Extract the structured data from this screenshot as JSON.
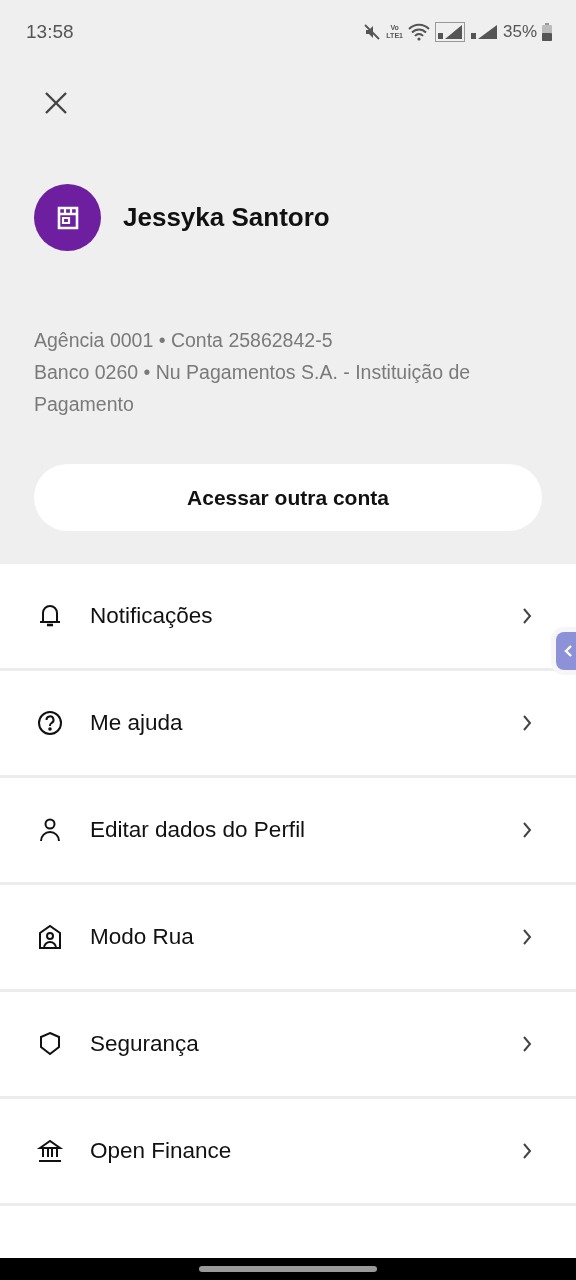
{
  "status_bar": {
    "time": "13:58",
    "network_label": [
      "Vo",
      "LTE1"
    ],
    "battery": "35%"
  },
  "profile": {
    "name": "Jessyka Santoro",
    "account_lines": [
      "Agência 0001 • Conta 25862842-5",
      "Banco 0260 • Nu Pagamentos S.A. - Instituição de Pagamento"
    ]
  },
  "switch_account_button": "Acessar outra conta",
  "menu": [
    {
      "label": "Notificações"
    },
    {
      "label": "Me ajuda"
    },
    {
      "label": "Editar dados do Perfil"
    },
    {
      "label": "Modo Rua"
    },
    {
      "label": "Segurança"
    },
    {
      "label": "Open Finance"
    }
  ]
}
